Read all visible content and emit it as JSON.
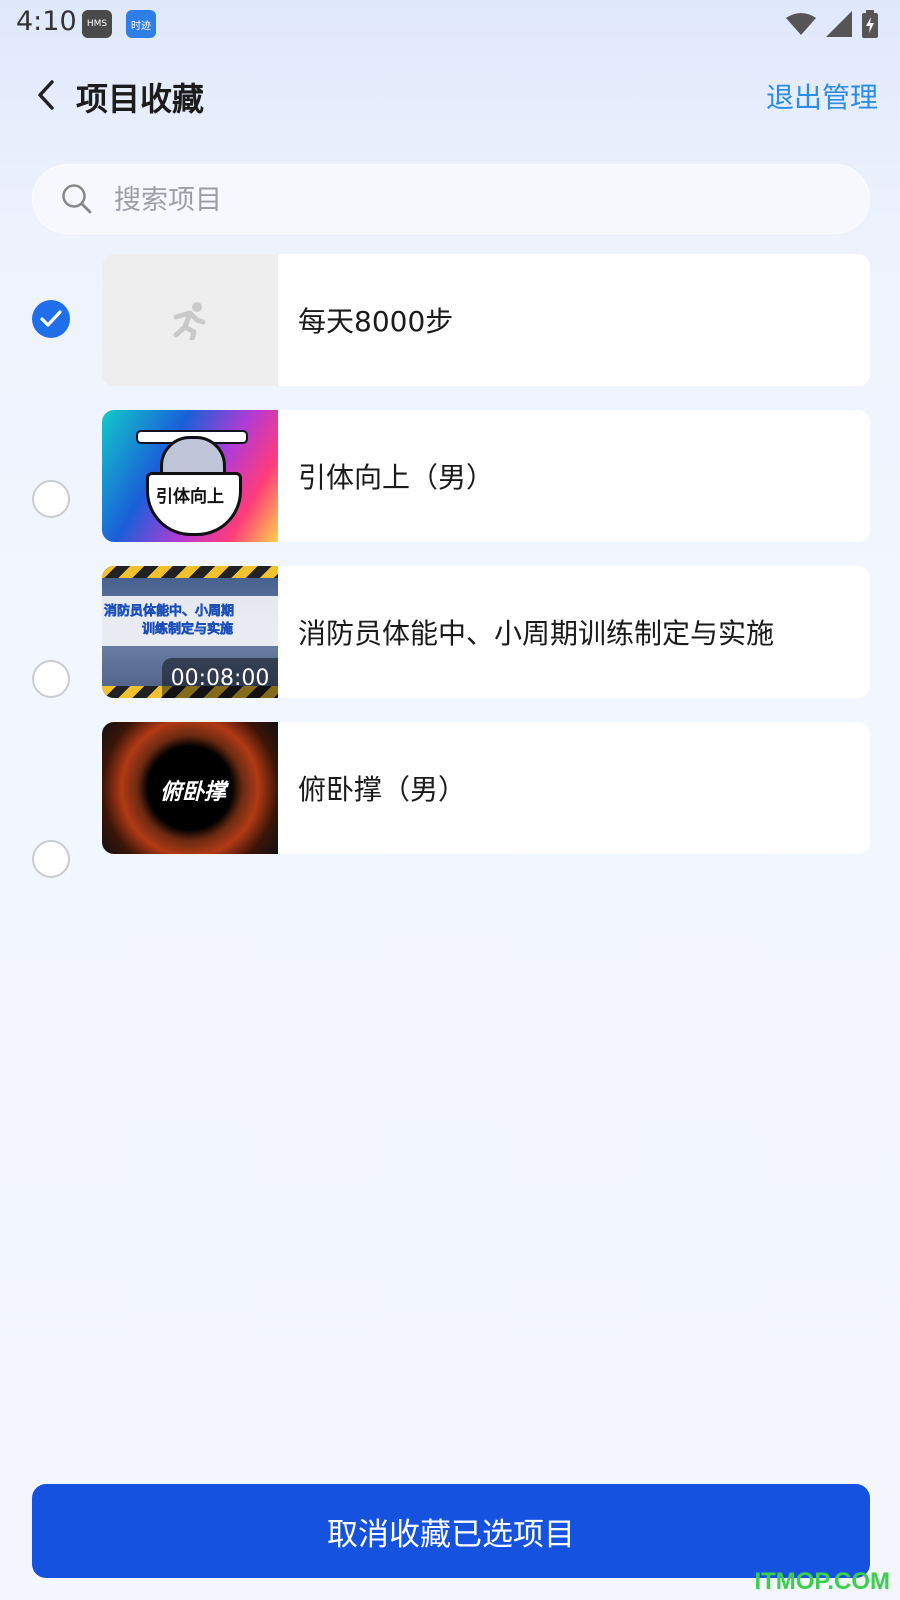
{
  "status_bar": {
    "time": "4:10",
    "badges": [
      "HMS",
      "时迹"
    ],
    "icons": [
      "wifi-icon",
      "signal-icon",
      "battery-charging-icon"
    ]
  },
  "header": {
    "title": "项目收藏",
    "action_label": "退出管理",
    "back_icon": "chevron-left-icon"
  },
  "search": {
    "placeholder": "搜索项目",
    "value": "",
    "icon": "search-icon"
  },
  "items": [
    {
      "title": "每天8000步",
      "selected": true,
      "thumbnail": "running-figure-icon"
    },
    {
      "title": "引体向上（男）",
      "selected": false,
      "thumbnail_text": "引体向上"
    },
    {
      "title": "消防员体能中、小周期训练制定与实施",
      "selected": false,
      "thumbnail_text_line1": "消防员体能中、小周期",
      "thumbnail_text_line2": "训练制定与实施",
      "duration": "00:08:00"
    },
    {
      "title": "俯卧撑（男）",
      "selected": false,
      "thumbnail_text": "俯卧撑"
    }
  ],
  "footer": {
    "button_label": "取消收藏已选项目"
  },
  "watermark": "ITMOP.COM",
  "colors": {
    "accent": "#1652e0",
    "link": "#2c8de6",
    "check": "#1f6fea"
  }
}
